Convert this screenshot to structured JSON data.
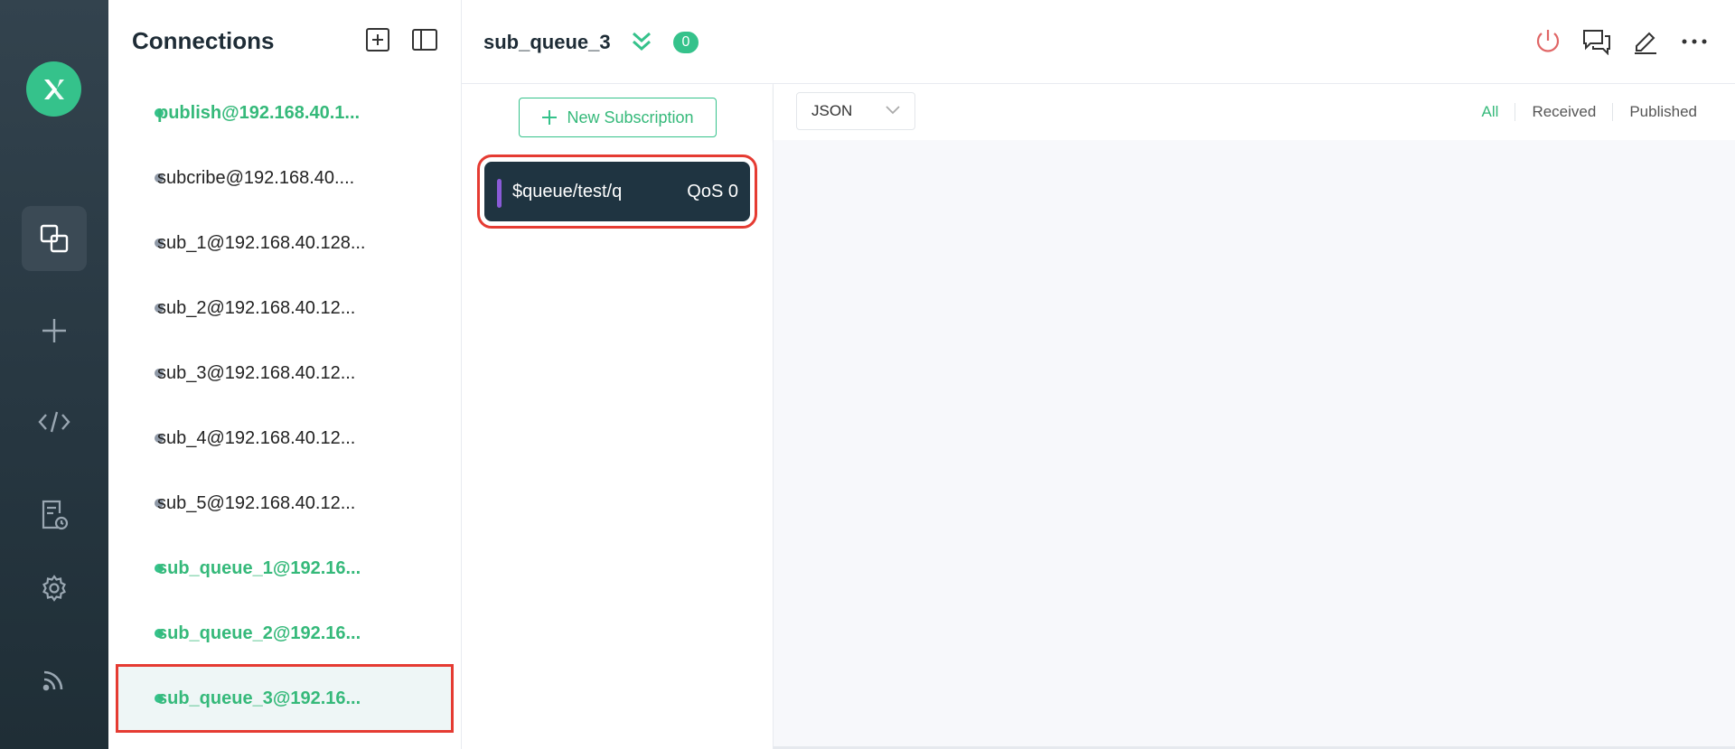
{
  "rail": {
    "icons": [
      "logo-icon",
      "connections-icon",
      "new-connection-icon",
      "script-icon",
      "log-icon",
      "settings-icon",
      "feed-icon"
    ]
  },
  "connections": {
    "title": "Connections",
    "items": [
      {
        "label": "publish@192.168.40.1...",
        "status": "online"
      },
      {
        "label": "subcribe@192.168.40....",
        "status": "offline"
      },
      {
        "label": "sub_1@192.168.40.128...",
        "status": "offline"
      },
      {
        "label": "sub_2@192.168.40.12...",
        "status": "offline"
      },
      {
        "label": "sub_3@192.168.40.12...",
        "status": "offline"
      },
      {
        "label": "sub_4@192.168.40.12...",
        "status": "offline"
      },
      {
        "label": "sub_5@192.168.40.12...",
        "status": "offline"
      },
      {
        "label": "sub_queue_1@192.16...",
        "status": "online"
      },
      {
        "label": "sub_queue_2@192.16...",
        "status": "online"
      },
      {
        "label": "sub_queue_3@192.16...",
        "status": "online"
      }
    ]
  },
  "header": {
    "title": "sub_queue_3",
    "badge": "0"
  },
  "subscriptions": {
    "new_label": "New Subscription",
    "items": [
      {
        "topic": "$queue/test/q",
        "qos": "QoS 0",
        "color": "#8a5bd8"
      }
    ]
  },
  "messages": {
    "format": "JSON",
    "filters": [
      "All",
      "Received",
      "Published"
    ]
  },
  "colors": {
    "accent": "#35c28b",
    "highlight": "#e53b32",
    "disconnect": "#e06666"
  }
}
